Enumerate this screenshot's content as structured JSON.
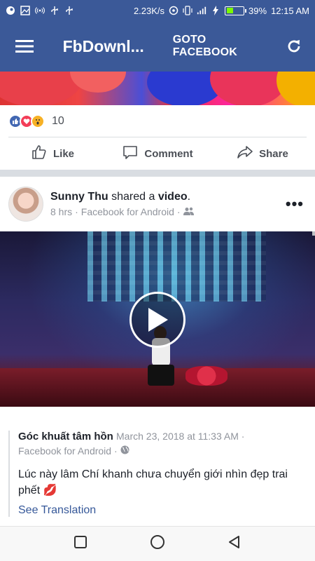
{
  "status_bar": {
    "net_speed": "2.23K/s",
    "battery_percent": "39%",
    "time": "12:15 AM",
    "battery_level": 0.39,
    "icons": [
      "steam-icon",
      "image-icon",
      "hotspot-icon",
      "usb-icon",
      "usb-icon",
      "data-saver-icon",
      "vibrate-icon",
      "signal-icon",
      "charging-icon",
      "battery-icon"
    ]
  },
  "app_bar": {
    "title": "FbDownl...",
    "goto_label": "GOTO FACEBOOK",
    "menu_icon": "hamburger-menu-icon",
    "refresh_icon": "refresh-icon",
    "color": "#3b5998"
  },
  "post1": {
    "reaction_count": "10",
    "reactions": [
      "like",
      "love",
      "wow"
    ],
    "actions": {
      "like": "Like",
      "comment": "Comment",
      "share": "Share"
    }
  },
  "post2": {
    "author": "Sunny Thu",
    "shared_text": "shared a",
    "object": "video",
    "period": ".",
    "time": "8 hrs",
    "source": "Facebook for Android",
    "shared": {
      "author": "Góc khuất tâm hồn",
      "time": "March 23, 2018 at 11:33 AM ·",
      "source": "Facebook for Android ·",
      "text": "Lúc này lâm Chí khanh chưa chuyển giới nhìn đẹp trai phết 💋",
      "see_translation": "See Translation"
    }
  },
  "nav_bar": {
    "icons": [
      "recents-square-icon",
      "home-circle-icon",
      "back-triangle-icon"
    ]
  }
}
